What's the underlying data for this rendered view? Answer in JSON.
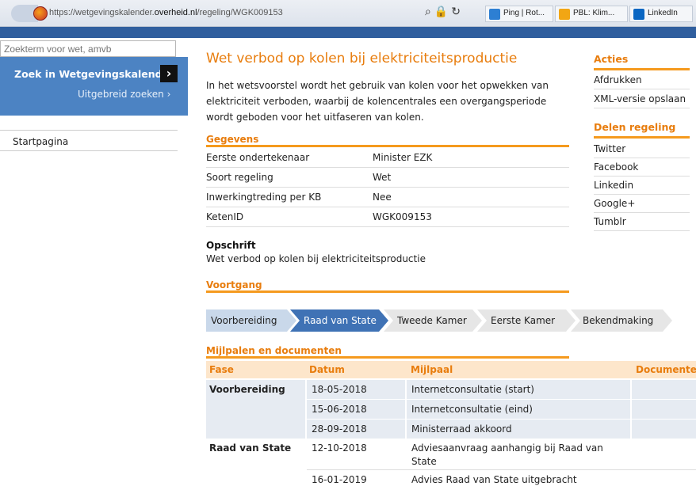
{
  "browser": {
    "url_prefix": "https://wetgevingskalender.",
    "url_domain": "overheid.nl",
    "url_path": "/regeling/WGK009153",
    "tabs": [
      {
        "label": "Ping | Rot...",
        "color": "#2d7fd3"
      },
      {
        "label": "PBL: Klim...",
        "color": "#f2a614"
      },
      {
        "label": "LinkedIn",
        "color": "#0a66c2"
      }
    ]
  },
  "sidebar": {
    "search_placeholder": "Zoekterm voor wet, amvb",
    "search_button": "Zoek in Wetgevingskalender",
    "advanced_link": "Uitgebreid zoeken ›",
    "home": "Startpagina"
  },
  "main": {
    "title": "Wet verbod op kolen bij elektriciteitsproductie",
    "intro": "In het wetsvoorstel wordt het gebruik van kolen voor het opwekken van elektriciteit verboden, waarbij de kolencentrales een overgangsperiode wordt geboden voor het uitfaseren van kolen.",
    "gegevens_heading": "Gegevens",
    "gegevens": [
      {
        "key": "Eerste ondertekenaar",
        "value": "Minister EZK"
      },
      {
        "key": "Soort regeling",
        "value": "Wet"
      },
      {
        "key": "Inwerkingtreding per KB",
        "value": "Nee"
      },
      {
        "key": "KetenID",
        "value": "WGK009153"
      }
    ],
    "opschrift_heading": "Opschrift",
    "opschrift_text": "Wet verbod op kolen bij elektriciteitsproductie",
    "voortgang_heading": "Voortgang",
    "steps": [
      {
        "label": "Voorbereiding",
        "state": "done"
      },
      {
        "label": "Raad van State",
        "state": "current"
      },
      {
        "label": "Tweede Kamer",
        "state": "todo"
      },
      {
        "label": "Eerste Kamer",
        "state": "todo"
      },
      {
        "label": "Bekendmaking",
        "state": "todo"
      }
    ],
    "milestones_heading": "Mijlpalen en documenten",
    "columns": [
      "Fase",
      "Datum",
      "Mijlpaal",
      "Documente"
    ],
    "milestones": [
      {
        "fase": "Voorbereiding",
        "datum": "18-05-2018",
        "mijlpaal": "Internetconsultatie (start)"
      },
      {
        "fase": "",
        "datum": "15-06-2018",
        "mijlpaal": "Internetconsultatie (eind)"
      },
      {
        "fase": "",
        "datum": "28-09-2018",
        "mijlpaal": "Ministerraad akkoord"
      },
      {
        "fase": "Raad van State",
        "datum": "12-10-2018",
        "mijlpaal": "Adviesaanvraag aanhangig bij Raad van State"
      },
      {
        "fase": "",
        "datum": "16-01-2019",
        "mijlpaal": "Advies Raad van State uitgebracht"
      }
    ]
  },
  "right": {
    "acties_heading": "Acties",
    "acties": [
      "Afdrukken",
      "XML-versie opslaan"
    ],
    "delen_heading": "Delen regeling",
    "delen": [
      "Twitter",
      "Facebook",
      "Linkedin",
      "Google+",
      "Tumblr"
    ]
  },
  "colors": {
    "accent_orange": "#e87d0e",
    "step_current": "#3f72b5",
    "step_done": "#c9d8ea",
    "step_todo": "#e6e6e6"
  }
}
